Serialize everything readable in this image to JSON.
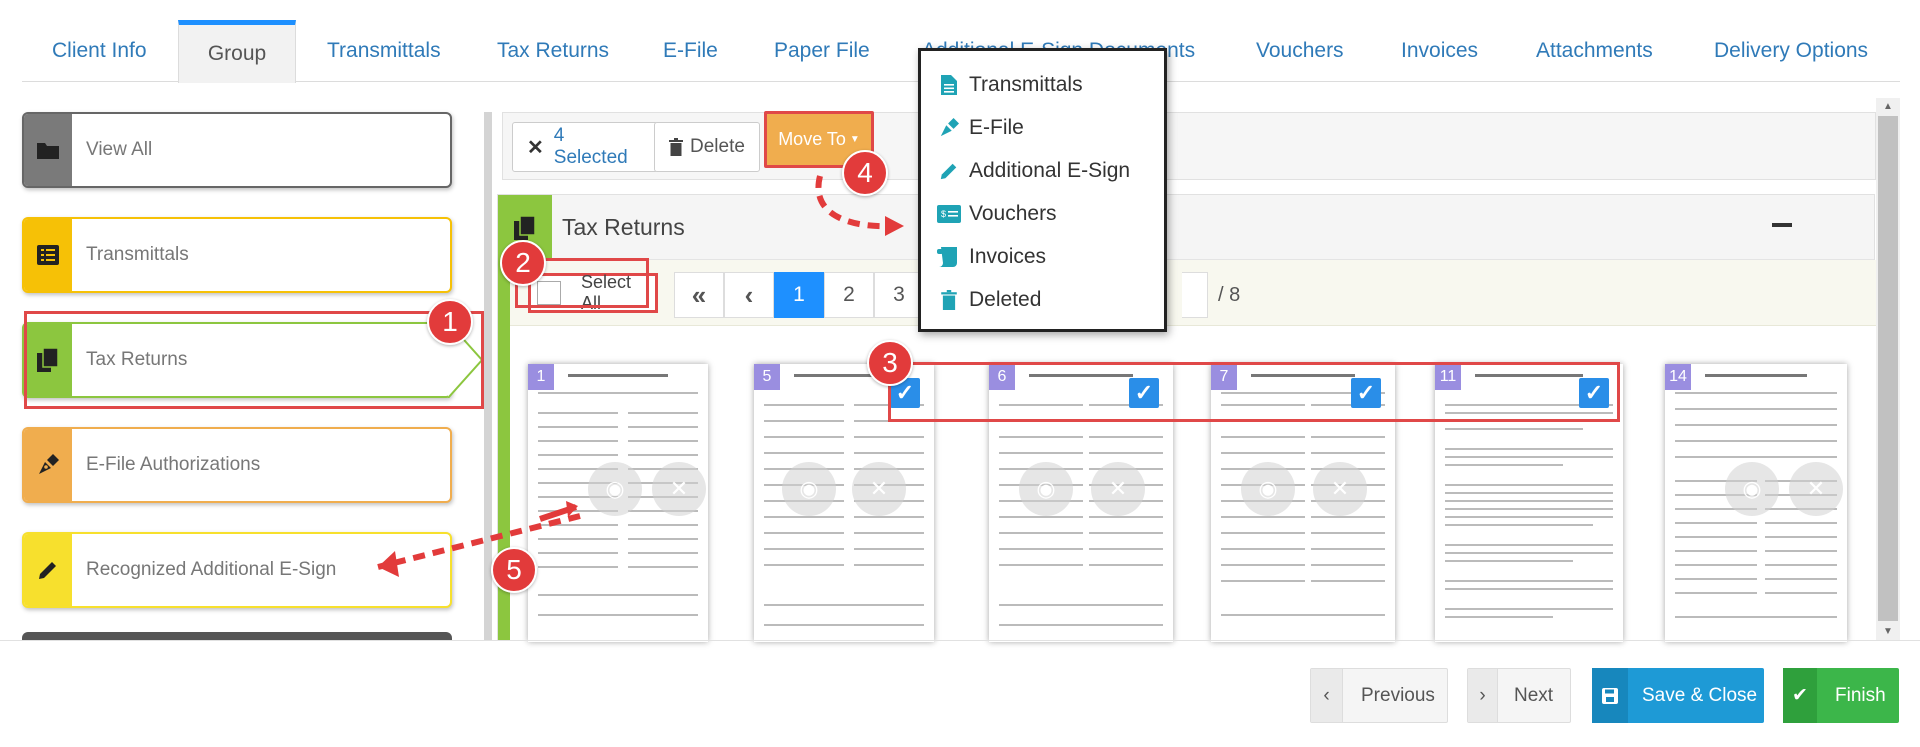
{
  "tabs": [
    {
      "label": "Client Info"
    },
    {
      "label": "Group"
    },
    {
      "label": "Transmittals"
    },
    {
      "label": "Tax Returns"
    },
    {
      "label": "E-File"
    },
    {
      "label": "Paper File"
    },
    {
      "label": "Additional E-Sign Documents"
    },
    {
      "label": "Vouchers"
    },
    {
      "label": "Invoices"
    },
    {
      "label": "Attachments"
    },
    {
      "label": "Delivery Options"
    }
  ],
  "active_tab": "Group",
  "sidebar": {
    "items": [
      {
        "label": "View All",
        "icon": "folder-icon",
        "color": "#7a7a7a"
      },
      {
        "label": "Transmittals",
        "icon": "list-icon",
        "color": "#f6c106"
      },
      {
        "label": "Tax Returns",
        "icon": "copy-icon",
        "color": "#8cc63f"
      },
      {
        "label": "E-File Authorizations",
        "icon": "pen-nib-icon",
        "color": "#f0ad4e"
      },
      {
        "label": "Recognized Additional E-Sign",
        "icon": "pencil-icon",
        "color": "#f7e02d"
      }
    ]
  },
  "toolbar": {
    "selected_label": "4 Selected",
    "delete_label": "Delete",
    "move_to_label": "Move To"
  },
  "move_menu": {
    "items": [
      {
        "label": "Transmittals",
        "icon": "document-icon"
      },
      {
        "label": "E-File",
        "icon": "pen-nib-icon"
      },
      {
        "label": "Additional E-Sign",
        "icon": "pencil-icon"
      },
      {
        "label": "Vouchers",
        "icon": "voucher-icon"
      },
      {
        "label": "Invoices",
        "icon": "scroll-icon"
      },
      {
        "label": "Deleted",
        "icon": "trash-icon"
      }
    ]
  },
  "panel": {
    "title": "Tax Returns",
    "select_all_label": "Select All",
    "pages": [
      "1",
      "2",
      "3"
    ],
    "current_page": "1",
    "total_pages": "/ 8"
  },
  "thumbnails": [
    {
      "num": "1",
      "checked": false
    },
    {
      "num": "5",
      "checked": true
    },
    {
      "num": "6",
      "checked": true
    },
    {
      "num": "7",
      "checked": true
    },
    {
      "num": "11",
      "checked": true
    },
    {
      "num": "14",
      "checked": false
    }
  ],
  "footer": {
    "previous_label": "Previous",
    "next_label": "Next",
    "save_close_label": "Save & Close",
    "finish_label": "Finish"
  },
  "annotations": [
    "1",
    "2",
    "3",
    "4",
    "5"
  ],
  "colors": {
    "accent_blue": "#1e90ff",
    "link_blue": "#2f7ab8",
    "move_to_orange": "#f0ad4e",
    "annotation_red": "#e23b3b",
    "save_blue": "#1e9ad6",
    "finish_green": "#3cb64a"
  }
}
